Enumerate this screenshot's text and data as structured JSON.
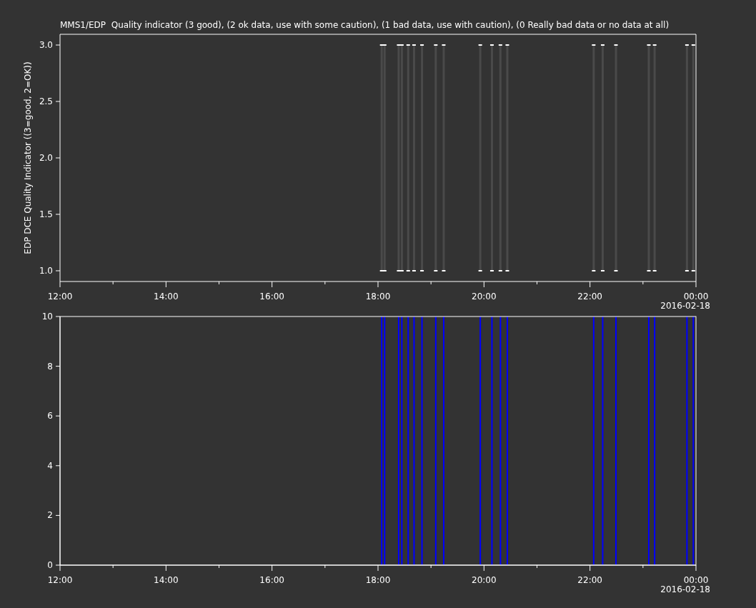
{
  "title": "MMS1/EDP  Quality indicator (3 good), (2 ok data, use with some caution), (1 bad data, use with caution), (0 Really bad data or no data at all)",
  "panels": [
    {
      "date_label": "2016-02-18",
      "chart_data": {
        "type": "scatter",
        "ylabel": "EDP DCE Quality Indicator ((3=good, 2=OK))",
        "x": [
          18.07,
          18.07,
          18.125,
          18.125,
          18.39,
          18.39,
          18.45,
          18.45,
          18.57,
          18.57,
          18.68,
          18.68,
          18.83,
          18.83,
          19.09,
          19.09,
          19.24,
          19.24,
          19.93,
          19.93,
          20.15,
          20.15,
          20.31,
          20.31,
          20.44,
          20.44,
          22.07,
          22.07,
          22.24,
          22.24,
          22.49,
          22.49,
          23.11,
          23.11,
          23.22,
          23.22,
          23.83,
          23.83,
          23.95,
          23.95
        ],
        "series": [
          {
            "color": "#ffffff",
            "values": [
              3,
              1,
              3,
              1,
              3,
              1,
              3,
              1,
              3,
              1,
              3,
              1,
              3,
              1,
              3,
              1,
              3,
              1,
              3,
              1,
              3,
              1,
              3,
              1,
              3,
              1,
              3,
              1,
              3,
              1,
              3,
              1,
              3,
              1,
              3,
              1,
              3,
              1,
              3,
              1
            ]
          }
        ],
        "xlim": [
          12,
          24
        ],
        "ylim": [
          0.905,
          3.095
        ],
        "xticks": [
          {
            "value": 12,
            "label": "12:00"
          },
          {
            "value": 14,
            "label": "14:00"
          },
          {
            "value": 16,
            "label": "16:00"
          },
          {
            "value": 18,
            "label": "18:00"
          },
          {
            "value": 20,
            "label": "20:00"
          },
          {
            "value": 22,
            "label": "22:00"
          },
          {
            "value": 24,
            "label": "00:00"
          }
        ],
        "yticks": [
          {
            "value": 1,
            "label": "1.0"
          },
          {
            "value": 1.5,
            "label": "1.5"
          },
          {
            "value": 2,
            "label": "2.0"
          },
          {
            "value": 2.5,
            "label": "2.5"
          },
          {
            "value": 3,
            "label": "3.0"
          }
        ]
      }
    },
    {
      "date_label": "2016-02-18",
      "chart_data": {
        "type": "bar",
        "x": [
          18.07,
          18.125,
          18.39,
          18.45,
          18.57,
          18.68,
          18.83,
          19.09,
          19.24,
          19.93,
          20.15,
          20.31,
          20.44,
          22.07,
          22.24,
          22.49,
          23.11,
          23.22,
          23.83,
          23.95
        ],
        "series": [
          {
            "color": "#0000ff",
            "values": [
              10,
              10,
              10,
              10,
              10,
              10,
              10,
              10,
              10,
              10,
              10,
              10,
              10,
              10,
              10,
              10,
              10,
              10,
              10,
              10
            ]
          }
        ],
        "xlim": [
          12,
          24
        ],
        "ylim": [
          0,
          10
        ],
        "xticks": [
          {
            "value": 12,
            "label": "12:00"
          },
          {
            "value": 14,
            "label": "14:00"
          },
          {
            "value": 16,
            "label": "16:00"
          },
          {
            "value": 18,
            "label": "18:00"
          },
          {
            "value": 20,
            "label": "20:00"
          },
          {
            "value": 22,
            "label": "22:00"
          },
          {
            "value": 24,
            "label": "00:00"
          }
        ],
        "yticks": [
          {
            "value": 0,
            "label": "0"
          },
          {
            "value": 2,
            "label": "2"
          },
          {
            "value": 4,
            "label": "4"
          },
          {
            "value": 6,
            "label": "6"
          },
          {
            "value": 8,
            "label": "8"
          },
          {
            "value": 10,
            "label": "10"
          }
        ]
      }
    }
  ]
}
